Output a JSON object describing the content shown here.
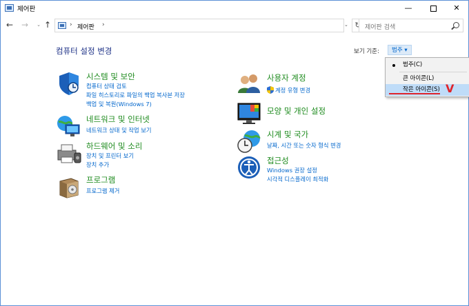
{
  "window": {
    "title": "제어판",
    "minimize": "—",
    "close": "✕"
  },
  "nav": {
    "back": "←",
    "forward": "→",
    "dropdown": "⌄",
    "up": "↑",
    "breadcrumb": [
      "제어판"
    ],
    "address_dropdown": "⌄",
    "refresh": "↻",
    "search_placeholder": "제어판 검색"
  },
  "main": {
    "heading": "컴퓨터 설정 변경",
    "view_by_label": "보기 기준:",
    "view_by_value": "범주 ▾"
  },
  "categories_left": [
    {
      "icon": "shield-security-icon",
      "title": "시스템 및 보안",
      "links": [
        "컴퓨터 상태 검토",
        "파일 히스토리로 파일의 백업 복사본 저장",
        "백업 및 복원(Windows 7)"
      ]
    },
    {
      "icon": "network-globe-icon",
      "title": "네트워크 및 인터넷",
      "links": [
        "네트워크 상태 및 작업 보기"
      ]
    },
    {
      "icon": "printer-hardware-icon",
      "title": "하드웨어 및 소리",
      "links": [
        "장치 및 프린터 보기",
        "장치 추가"
      ]
    },
    {
      "icon": "programs-box-icon",
      "title": "프로그램",
      "links": [
        "프로그램 제거"
      ]
    }
  ],
  "categories_right": [
    {
      "icon": "user-accounts-icon",
      "title": "사용자 계정",
      "links": [
        "계정 유형 변경"
      ]
    },
    {
      "icon": "appearance-monitor-icon",
      "title": "모양 및 개인 설정",
      "links": []
    },
    {
      "icon": "clock-globe-icon",
      "title": "시계 및 국가",
      "links": [
        "날짜, 시간 또는 숫자 형식 변경"
      ]
    },
    {
      "icon": "ease-of-access-icon",
      "title": "접근성",
      "links": [
        "Windows 권장 설정",
        "시각적 디스플레이 최적화"
      ]
    }
  ],
  "menu": {
    "items": [
      "범주(C)",
      "큰 아이콘(L)",
      "작은 아이콘(S)"
    ],
    "selected_index": 0,
    "highlighted_index": 2,
    "annotation": "V"
  },
  "colors": {
    "category_title": "#1e8b1e",
    "link": "#0066cc",
    "heading": "#1e3287",
    "annotation_red": "#e0242a",
    "menu_highlight": "#bfdcf8"
  }
}
